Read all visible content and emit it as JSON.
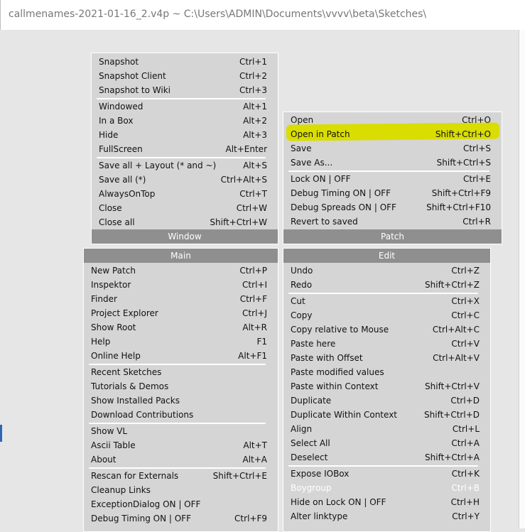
{
  "title_text": "callmenames-2021-01-16_2.v4p ~  C:\\Users\\ADMIN\\Documents\\vvvv\\beta\\Sketches\\",
  "window_menu": {
    "footer": "Window",
    "items": [
      {
        "label": "Snapshot",
        "shortcut": "Ctrl+1"
      },
      {
        "label": "Snapshot Client",
        "shortcut": "Ctrl+2"
      },
      {
        "label": "Snapshot to Wiki",
        "shortcut": "Ctrl+3"
      },
      {
        "label": "Windowed",
        "shortcut": "Alt+1"
      },
      {
        "label": "In a Box",
        "shortcut": "Alt+2"
      },
      {
        "label": "Hide",
        "shortcut": "Alt+3"
      },
      {
        "label": "FullScreen",
        "shortcut": "Alt+Enter"
      },
      {
        "label": "Save all + Layout (* and ~)",
        "shortcut": "Alt+S"
      },
      {
        "label": "Save all (*)",
        "shortcut": "Ctrl+Alt+S"
      },
      {
        "label": "AlwaysOnTop",
        "shortcut": "Ctrl+T"
      },
      {
        "label": "Close",
        "shortcut": "Ctrl+W"
      },
      {
        "label": "Close all",
        "shortcut": "Shift+Ctrl+W"
      }
    ]
  },
  "patch_menu": {
    "footer": "Patch",
    "items": [
      {
        "label": "Open",
        "shortcut": "Ctrl+O"
      },
      {
        "label": "Open in Patch",
        "shortcut": "Shift+Ctrl+O"
      },
      {
        "label": "Save",
        "shortcut": "Ctrl+S"
      },
      {
        "label": "Save As...",
        "shortcut": "Shift+Ctrl+S"
      },
      {
        "label": "Lock ON | OFF",
        "shortcut": "Ctrl+E"
      },
      {
        "label": "Debug Timing ON | OFF",
        "shortcut": "Shift+Ctrl+F9"
      },
      {
        "label": "Debug Spreads ON | OFF",
        "shortcut": "Shift+Ctrl+F10"
      },
      {
        "label": "Revert to saved",
        "shortcut": "Ctrl+R"
      }
    ]
  },
  "main_menu": {
    "header": "Main",
    "items": [
      {
        "label": "New Patch",
        "shortcut": "Ctrl+P"
      },
      {
        "label": "Inspektor",
        "shortcut": "Ctrl+I"
      },
      {
        "label": "Finder",
        "shortcut": "Ctrl+F"
      },
      {
        "label": "Project Explorer",
        "shortcut": "Ctrl+J"
      },
      {
        "label": "Show Root",
        "shortcut": "Alt+R"
      },
      {
        "label": "Help",
        "shortcut": "F1"
      },
      {
        "label": "Online Help",
        "shortcut": "Alt+F1"
      },
      {
        "label": "Recent Sketches",
        "shortcut": ""
      },
      {
        "label": "Tutorials & Demos",
        "shortcut": ""
      },
      {
        "label": "Show Installed Packs",
        "shortcut": ""
      },
      {
        "label": "Download Contributions",
        "shortcut": ""
      },
      {
        "label": "Show VL",
        "shortcut": ""
      },
      {
        "label": "Ascii Table",
        "shortcut": "Alt+T"
      },
      {
        "label": "About",
        "shortcut": "Alt+A"
      },
      {
        "label": "Rescan for Externals",
        "shortcut": "Shift+Ctrl+E"
      },
      {
        "label": "Cleanup Links",
        "shortcut": ""
      },
      {
        "label": "ExceptionDialog ON | OFF",
        "shortcut": ""
      },
      {
        "label": "Debug Timing ON | OFF",
        "shortcut": "Ctrl+F9"
      }
    ]
  },
  "edit_menu": {
    "header": "Edit",
    "items": [
      {
        "label": "Undo",
        "shortcut": "Ctrl+Z"
      },
      {
        "label": "Redo",
        "shortcut": "Shift+Ctrl+Z"
      },
      {
        "label": "Cut",
        "shortcut": "Ctrl+X"
      },
      {
        "label": "Copy",
        "shortcut": "Ctrl+C"
      },
      {
        "label": "Copy relative to Mouse",
        "shortcut": "Ctrl+Alt+C"
      },
      {
        "label": "Paste here",
        "shortcut": "Ctrl+V"
      },
      {
        "label": "Paste with Offset",
        "shortcut": "Ctrl+Alt+V"
      },
      {
        "label": "Paste modified values",
        "shortcut": ""
      },
      {
        "label": "Paste within Context",
        "shortcut": "Shift+Ctrl+V"
      },
      {
        "label": "Duplicate",
        "shortcut": "Ctrl+D"
      },
      {
        "label": "Duplicate Within Context",
        "shortcut": "Shift+Ctrl+D"
      },
      {
        "label": "Align",
        "shortcut": "Ctrl+L"
      },
      {
        "label": "Select All",
        "shortcut": "Ctrl+A"
      },
      {
        "label": "Deselect",
        "shortcut": "Shift+Ctrl+A"
      },
      {
        "label": "Expose IOBox",
        "shortcut": "Ctrl+K"
      },
      {
        "label": "Boygroup",
        "shortcut": "Ctrl+B",
        "disabled": true
      },
      {
        "label": "Hide on Lock ON | OFF",
        "shortcut": "Ctrl+H"
      },
      {
        "label": "Alter linktype",
        "shortcut": "Ctrl+Y"
      }
    ]
  },
  "highlight_color": "#d9dd00"
}
